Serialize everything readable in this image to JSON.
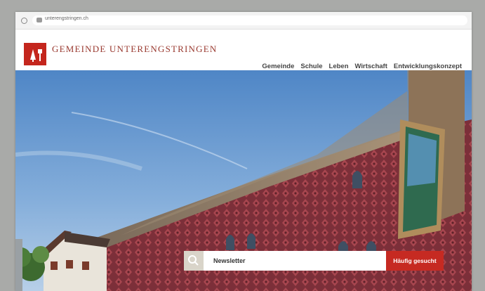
{
  "browser": {
    "url": "unterengstringen.ch"
  },
  "site": {
    "name": "Gemeinde Unterengstringen"
  },
  "nav": [
    "Gemeinde",
    "Schule",
    "Leben",
    "Wirtschaft",
    "Entwicklungskonzept"
  ],
  "search": {
    "placeholder": "Newsletter",
    "button": "Häufig gesucht"
  },
  "colors": {
    "brand_red": "#c4261d",
    "sky": "#6b9ad0",
    "facade": "#7a2e36"
  }
}
